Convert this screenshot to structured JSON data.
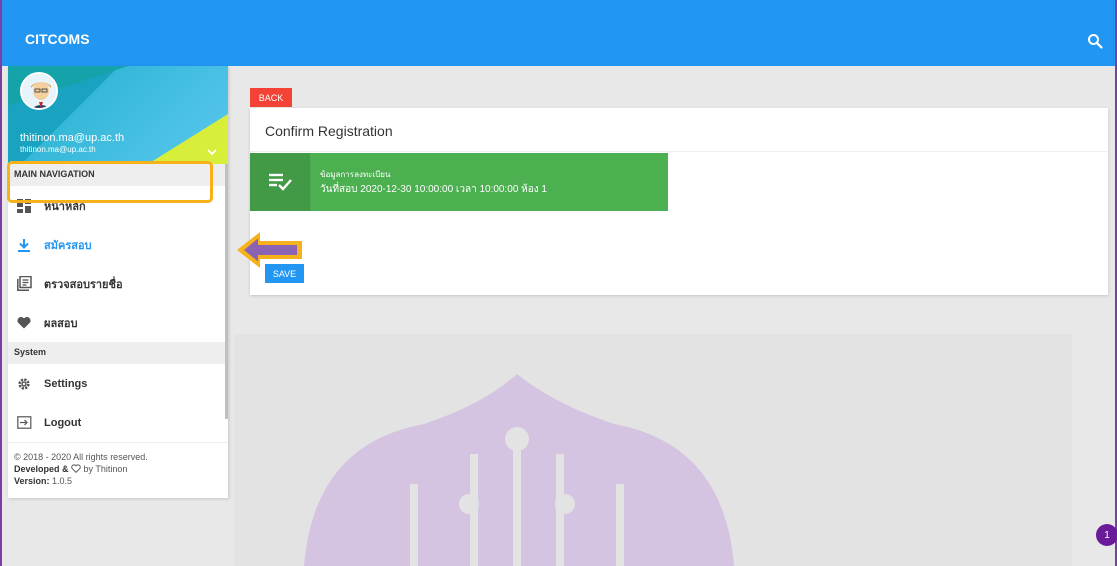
{
  "app": {
    "title": "CITCOMS"
  },
  "user": {
    "name": "thitinon.ma@up.ac.th",
    "email": "thitinon.ma@up.ac.th"
  },
  "nav": {
    "main_header": "MAIN NAVIGATION",
    "items": [
      {
        "label": "หน้าหลัก",
        "icon": "dashboard-icon"
      },
      {
        "label": "สมัครสอบ",
        "icon": "download-icon",
        "active": true
      },
      {
        "label": "ตรวจสอบรายชื่อ",
        "icon": "list-icon"
      },
      {
        "label": "ผลสอบ",
        "icon": "heart-icon"
      }
    ],
    "system_header": "System",
    "system_items": [
      {
        "label": "Settings",
        "icon": "gear-icon"
      },
      {
        "label": "Logout",
        "icon": "logout-icon"
      }
    ]
  },
  "footer": {
    "copyright": "© 2018 - 2020 All rights reserved.",
    "developed_prefix": "Developed &",
    "developed_by": "by Thitinon",
    "version_label": "Version:",
    "version": "1.0.5"
  },
  "main": {
    "back_label": "BACK",
    "card_title": "Confirm Registration",
    "info": {
      "line1": "ข้อมูลการลงทะเบียน",
      "line2": "วันที่สอบ 2020-12-30 10:00:00 เวลา 10:00:00 ห้อง 1"
    },
    "save_label": "SAVE"
  },
  "badge": {
    "count": "1"
  },
  "colors": {
    "primary": "#2196f3",
    "success": "#4caf50",
    "danger": "#f44336",
    "highlight": "#f7b21b",
    "arrow": "#8a63b5"
  }
}
